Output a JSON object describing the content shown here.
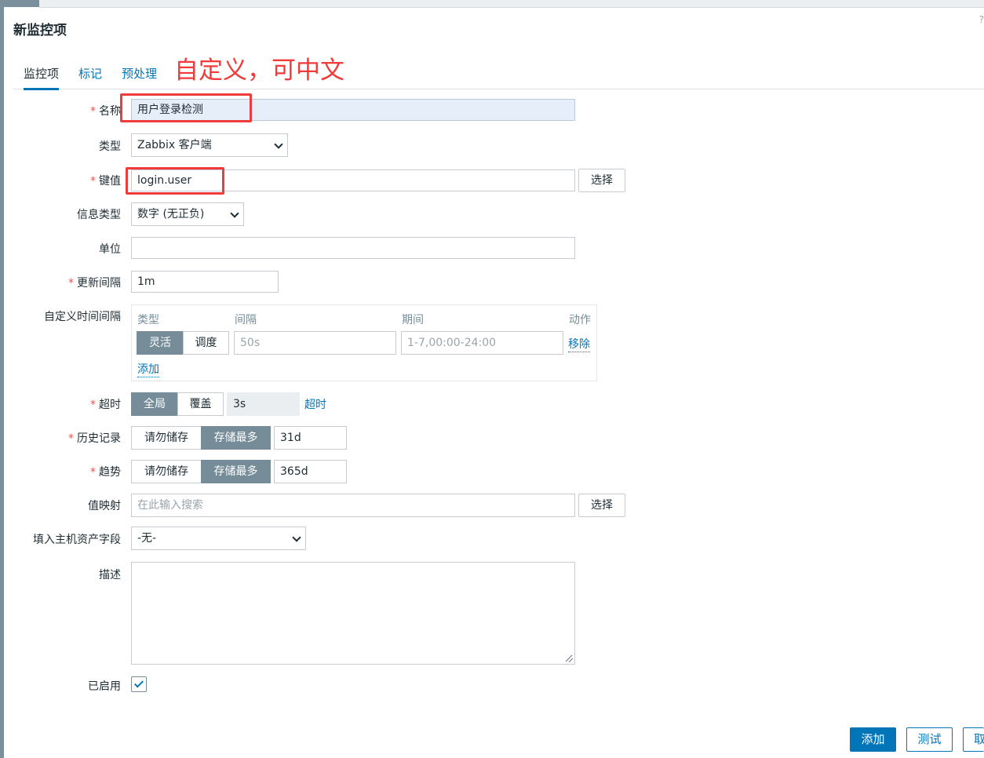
{
  "dialog": {
    "title": "新监控项",
    "corner_glyph": "?"
  },
  "tabs": [
    {
      "label": "监控项",
      "active": true
    },
    {
      "label": "标记",
      "active": false
    },
    {
      "label": "预处理",
      "active": false
    }
  ],
  "annotation": {
    "text": "自定义，可中文",
    "color": "#f23a3a"
  },
  "form": {
    "name": {
      "label": "名称",
      "required": true,
      "value": "用户登录检测"
    },
    "type": {
      "label": "类型",
      "value": "Zabbix 客户端"
    },
    "key": {
      "label": "键值",
      "required": true,
      "value": "login.user",
      "select_button": "选择"
    },
    "info_type": {
      "label": "信息类型",
      "value": "数字 (无正负)"
    },
    "units": {
      "label": "单位",
      "value": ""
    },
    "update_interval": {
      "label": "更新间隔",
      "required": true,
      "value": "1m"
    },
    "custom_intervals": {
      "label": "自定义时间间隔",
      "headers": {
        "type": "类型",
        "interval": "间隔",
        "period": "期间",
        "action": "动作"
      },
      "mode_options": [
        "灵活",
        "调度"
      ],
      "mode_selected": "灵活",
      "interval_placeholder": "50s",
      "period_placeholder": "1-7,00:00-24:00",
      "remove_link": "移除",
      "add_link": "添加"
    },
    "timeout": {
      "label": "超时",
      "required": true,
      "options": [
        "全局",
        "覆盖"
      ],
      "selected": "全局",
      "value": "3s",
      "link": "超时"
    },
    "history": {
      "label": "历史记录",
      "required": true,
      "options": [
        "请勿储存",
        "存储最多"
      ],
      "selected": "存储最多",
      "value": "31d"
    },
    "trends": {
      "label": "趋势",
      "required": true,
      "options": [
        "请勿储存",
        "存储最多"
      ],
      "selected": "存储最多",
      "value": "365d"
    },
    "value_map": {
      "label": "值映射",
      "placeholder": "在此输入搜索",
      "select_button": "选择"
    },
    "inventory_field": {
      "label": "填入主机资产字段",
      "value": "-无-"
    },
    "description": {
      "label": "描述",
      "value": ""
    },
    "enabled": {
      "label": "已启用",
      "checked": true
    }
  },
  "buttons": {
    "add": "添加",
    "test": "测试",
    "cancel": "取消"
  },
  "colors": {
    "accent": "#0275b8",
    "segment_active": "#768d99",
    "required_star": "#e45959",
    "annotation_box": "#ef3b3b"
  }
}
